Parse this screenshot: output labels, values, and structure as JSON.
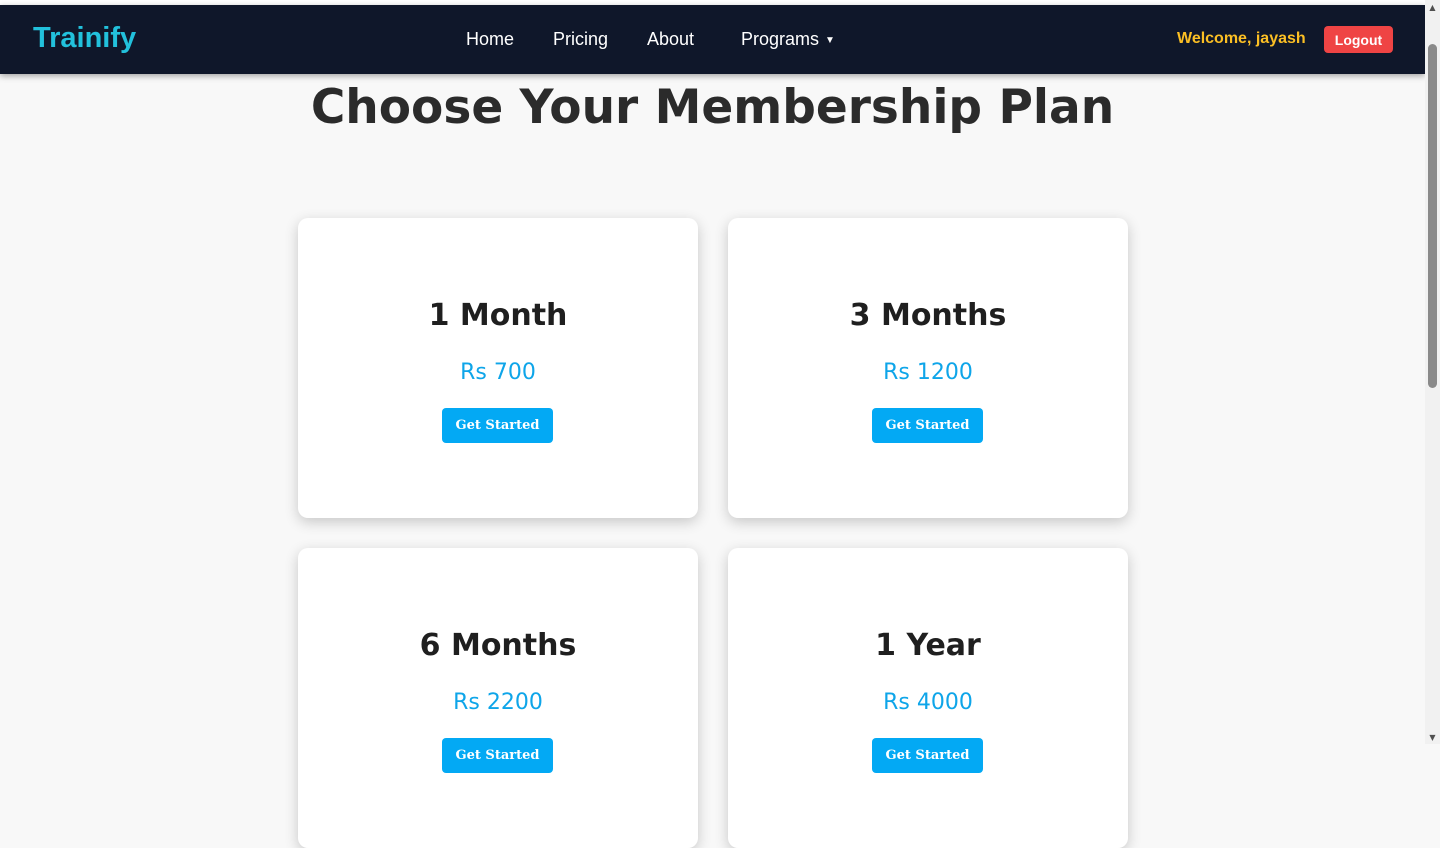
{
  "navbar": {
    "brand": "Trainify",
    "links": [
      "Home",
      "Pricing",
      "About"
    ],
    "programs_label": "Programs",
    "programs_caret": "▼",
    "welcome": "Welcome, jayash",
    "logout_label": "Logout"
  },
  "main": {
    "title": "Choose Your Membership Plan",
    "plans": [
      {
        "name": "1 Month",
        "price": "Rs 700",
        "button": "Get Started"
      },
      {
        "name": "3 Months",
        "price": "Rs 1200",
        "button": "Get Started"
      },
      {
        "name": "6 Months",
        "price": "Rs 2200",
        "button": "Get Started"
      },
      {
        "name": "1 Year",
        "price": "Rs 4000",
        "button": "Get Started"
      }
    ]
  },
  "scrollbar": {
    "up_arrow": "▲",
    "down_arrow": "▼"
  },
  "colors": {
    "navbar_bg": "#0f172a",
    "brand": "#22c1dc",
    "welcome": "#fbbf24",
    "logout_bg": "#ef4444",
    "accent": "#03a9f4",
    "page_bg": "#f8f8f8"
  }
}
